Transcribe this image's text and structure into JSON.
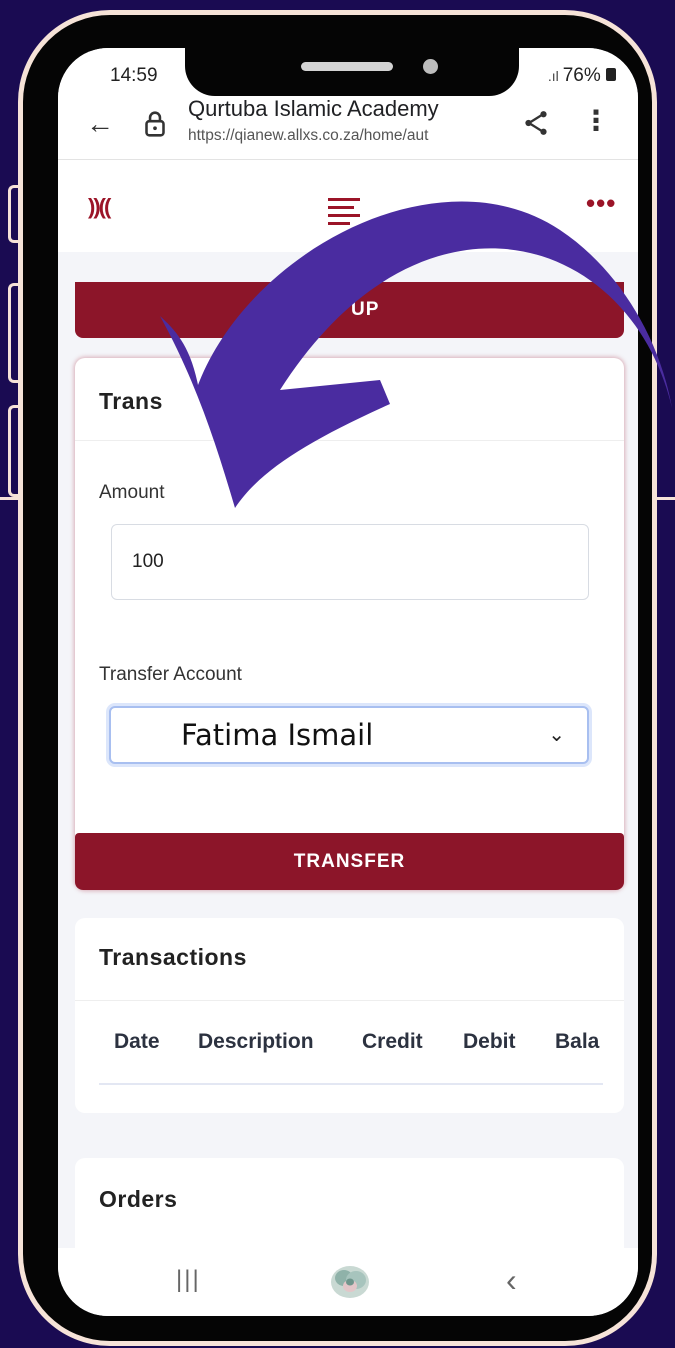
{
  "status_bar": {
    "time": "14:59",
    "battery": "76%"
  },
  "browser": {
    "site_title": "Qurtuba Islamic Academy",
    "url": "https://qianew.allxs.co.za/home/aut"
  },
  "top_up": {
    "button_label": "UP"
  },
  "transfer": {
    "title": "Trans",
    "amount_label": "Amount",
    "amount_value": "100",
    "account_label": "Transfer Account",
    "account_selected": "Fatima Ismail",
    "button_label": "TRANSFER"
  },
  "transactions": {
    "title": "Transactions",
    "columns": [
      "Date",
      "Description",
      "Credit",
      "Debit",
      "Bala"
    ]
  },
  "orders": {
    "title": "Orders"
  },
  "colors": {
    "brand": "#8c1529",
    "arrow": "#4a2ca0",
    "background": "#1a0b52",
    "frame": "#f6e3d8"
  },
  "icons": [
    "back-arrow-icon",
    "lock-icon",
    "share-icon",
    "kebab-menu-icon",
    "logo-icon",
    "hamburger-icon",
    "more-dots-icon",
    "chevron-down-icon",
    "recents-icon",
    "home-icon",
    "back-nav-icon",
    "curved-arrow-icon"
  ]
}
